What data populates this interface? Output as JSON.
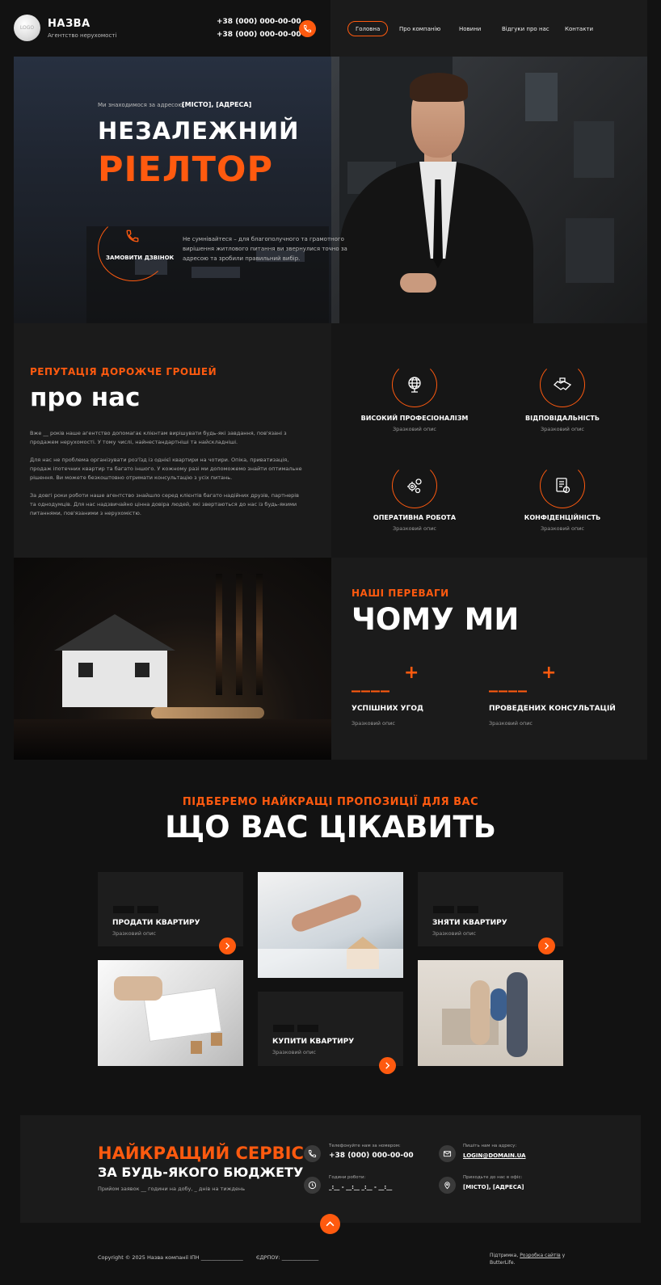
{
  "header": {
    "logo": "LOGO",
    "brand": "НАЗВА",
    "brand_sub": "Агентство нерухомості",
    "phones": [
      "+38 (000) 000-00-00",
      "+38 (000) 000-00-00"
    ],
    "nav": [
      "Головна",
      "Про компанію",
      "Новини",
      "Відгуки про нас",
      "Контакти"
    ]
  },
  "hero": {
    "location_label": "Ми знаходимося за адресою:",
    "location_value": "[МІСТО], [АДРЕСА]",
    "title_line1": "НЕЗАЛЕЖНИЙ",
    "title_line2": "РІЕЛТОР",
    "call_button": "ЗАМОВИТИ ДЗВІНОК",
    "description": "Не сумнівайтеся – для благополучного та грамотного вирішення житлового питання ви звернулися точно за адресою та зробили правильний вибір."
  },
  "about": {
    "subtitle": "РЕПУТАЦІЯ ДОРОЖЧЕ ГРОШЕЙ",
    "title": "про нас",
    "paragraphs": [
      "Вже __ років наше агентство допомагає клієнтам вирішувати будь-які завдання, пов'язані з продажем нерухомості. У тому числі, найнестандартніші та найскладніші.",
      "Для нас не проблема організувати роз'їзд із однієї квартири на чотири. Опіка, приватизація, продаж іпотечних квартир та багато іншого. У кожному разі ми допоможемо знайти оптимальне рішення. Ви можете безкоштовно отримати консультацію з усіх питань.",
      "За довгі роки роботи наше агентство знайшло серед клієнтів багато надійних друзів, партнерів та однодумців. Для нас надзвичайно цінна довіра людей, які звертаються до нас із будь-якими питаннями, пов'язаними з нерухомістю."
    ],
    "features": [
      {
        "title": "ВИСОКИЙ ПРОФЕСІОНАЛІЗМ",
        "desc": "Зразковий опис",
        "icon": "globe-icon"
      },
      {
        "title": "ВІДПОВІДАЛЬНІСТЬ",
        "desc": "Зразковий опис",
        "icon": "handshake-icon"
      },
      {
        "title": "ОПЕРАТИВНА РОБОТА",
        "desc": "Зразковий опис",
        "icon": "gears-icon"
      },
      {
        "title": "КОНФІДЕНЦІЙНІСТЬ",
        "desc": "Зразковий опис",
        "icon": "document-icon"
      }
    ]
  },
  "why": {
    "subtitle": "НАШІ ПЕРЕВАГИ",
    "title": "ЧОМУ МИ",
    "stats": [
      {
        "value": "____",
        "plus": "+",
        "title": "УСПІШНИХ УГОД",
        "desc": "Зразковий опис"
      },
      {
        "value": "____",
        "plus": "+",
        "title": "ПРОВЕДЕНИХ КОНСУЛЬТАЦІЙ",
        "desc": "Зразковий опис"
      }
    ]
  },
  "services": {
    "subtitle": "ПІДБЕРЕМО НАЙКРАЩІ ПРОПОЗИЦІЇ ДЛЯ ВАС",
    "title": "ЩО ВАС ЦІКАВИТЬ",
    "cards": [
      {
        "title": "ПРОДАТИ КВАРТИРУ",
        "desc": "Зразковий опис"
      },
      {
        "title": "ЗНЯТИ КВАРТИРУ",
        "desc": "Зразковий опис"
      },
      {
        "title": "КУПИТИ КВАРТИРУ",
        "desc": "Зразковий опис"
      }
    ]
  },
  "contact": {
    "title1": "НАЙКРАЩИЙ СЕРВІС",
    "title2": "ЗА БУДЬ-ЯКОГО БЮДЖЕТУ",
    "note": "Прийом заявок __ години на добу, _ днів на тиждень",
    "phone_label": "Телефонуйте нам за номером:",
    "phone": "+38 (000) 000-00-00",
    "email_label": "Пишіть нам на адресу:",
    "email": "LOGIN@DOMAIN.UA",
    "hours_label": "Години роботи:",
    "hours": "_:__ - __:__ _:__ - __:__",
    "office_label": "Приходьте до нас в офіс:",
    "office": "[МІСТО], [АДРЕСА]"
  },
  "footer": {
    "copyright": "Copyright © 2025 Назва компанії",
    "ipn": "ІПН ________________",
    "edrpou": "ЄДРПОУ: ______________",
    "support_prefix": "Підтримка,",
    "support_link": "Розробка сайтів",
    "support_suffix": "у ButterLife."
  },
  "colors": {
    "accent": "#ff5a0f",
    "bg": "#121212",
    "panel": "#1b1b1b"
  }
}
